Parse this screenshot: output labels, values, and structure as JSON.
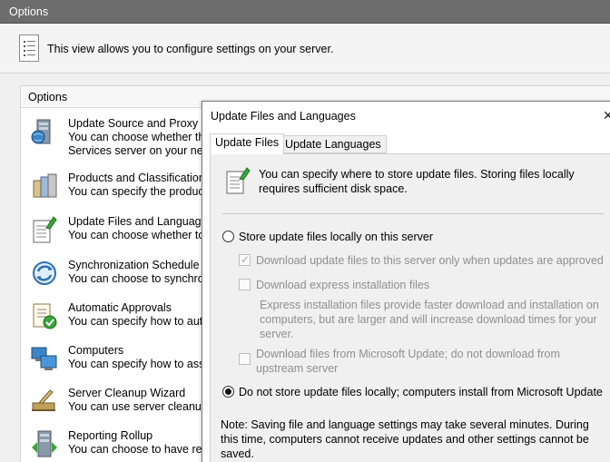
{
  "window": {
    "title": "Options"
  },
  "info": {
    "text": "This view allows you to configure settings on your server."
  },
  "options": {
    "header": "Options",
    "items": [
      {
        "title": "Update Source and Proxy Se",
        "line1": "You can choose whether this",
        "line2": "Services server on your netw",
        "icon": "server-globe-icon"
      },
      {
        "title": "Products and Classifications",
        "line1": "You can specify the products",
        "icon": "products-icon"
      },
      {
        "title": "Update Files and Languages",
        "line1": "You can choose whether to d",
        "icon": "update-files-icon"
      },
      {
        "title": "Synchronization Schedule",
        "line1": "You can choose to synchron",
        "icon": "sync-icon"
      },
      {
        "title": "Automatic Approvals",
        "line1": "You can specify how to auto",
        "icon": "approvals-icon"
      },
      {
        "title": "Computers",
        "line1": "You can specify how to assig",
        "icon": "computers-icon"
      },
      {
        "title": "Server Cleanup Wizard",
        "line1": "You can use server cleanup t",
        "icon": "cleanup-icon"
      },
      {
        "title": "Reporting Rollup",
        "line1": "You can choose to have repl",
        "icon": "rollup-icon"
      }
    ]
  },
  "dialog": {
    "title": "Update Files and Languages",
    "close": "✕",
    "tabs": [
      "Update Files",
      "Update Languages"
    ],
    "intro": "You can specify where to store update files. Storing files locally requires sufficient disk space.",
    "radio_local": "Store update files locally on this server",
    "chk_download_approved": "Download update files to this server only when updates are approved",
    "chk_express": "Download express installation files",
    "express_note": "Express installation files provide faster download and installation on computers, but are larger and will increase download times for your server.",
    "chk_microsoft": "Download files from Microsoft Update; do not download from upstream server",
    "radio_no_local": "Do not store update files locally; computers install from Microsoft Update",
    "note": "Note: Saving file and language settings may take several minutes. During this time, computers cannot receive updates and other settings cannot be saved."
  }
}
